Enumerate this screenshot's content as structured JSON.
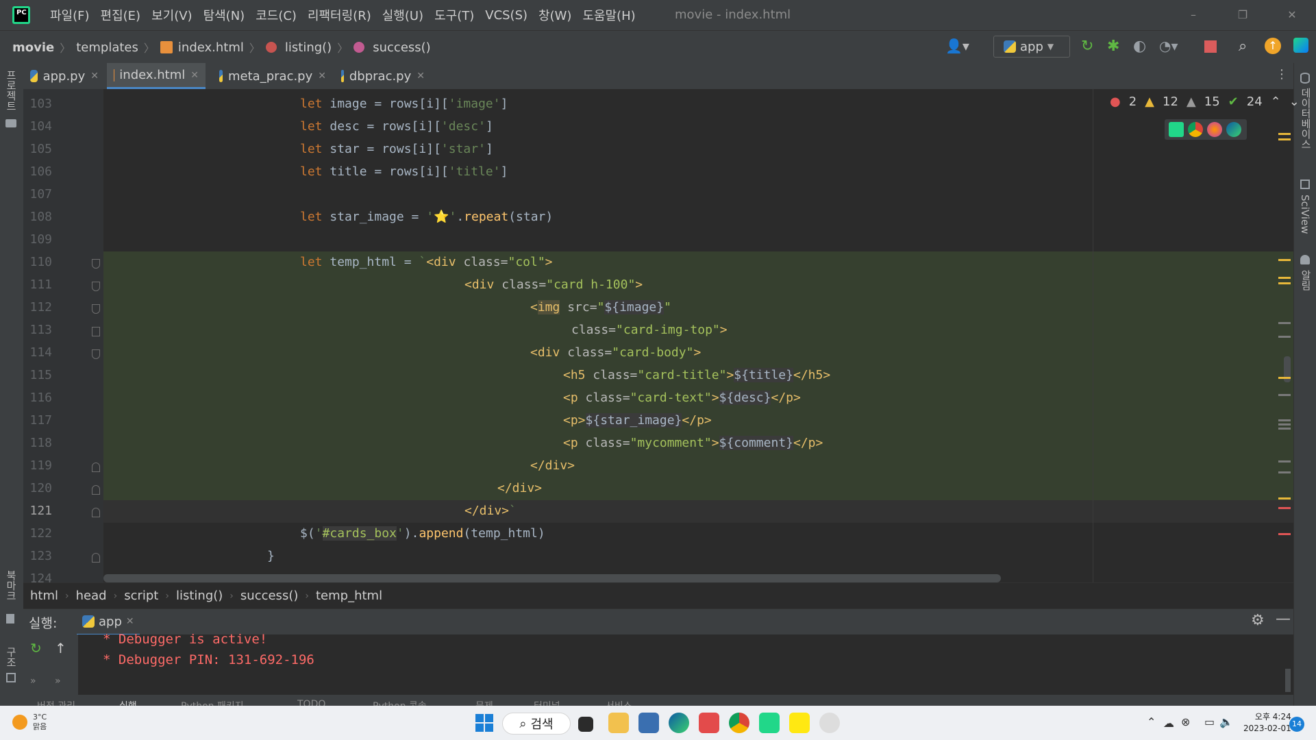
{
  "titlebar": {
    "app_icon": "pycharm-icon",
    "menu": [
      "파일(F)",
      "편집(E)",
      "보기(V)",
      "탐색(N)",
      "코드(C)",
      "리팩터링(R)",
      "실행(U)",
      "도구(T)",
      "VCS(S)",
      "창(W)",
      "도움말(H)"
    ],
    "window_title": "movie - index.html",
    "minimize": "–",
    "restore": "❐",
    "close": "✕"
  },
  "navbar": {
    "breadcrumb": [
      "movie",
      "templates",
      "index.html",
      "listing()",
      "success()"
    ],
    "run_config": "app"
  },
  "tabs": [
    {
      "label": "app.py",
      "icon": "python-file-icon"
    },
    {
      "label": "index.html",
      "icon": "html-file-icon"
    },
    {
      "label": "meta_prac.py",
      "icon": "python-file-icon"
    },
    {
      "label": "dbprac.py",
      "icon": "python-file-icon"
    }
  ],
  "left_strip": {
    "project": "프로젝트",
    "structure": "구조",
    "bookmarks": "북마크"
  },
  "right_strip": {
    "database": "데이터베이스",
    "sciview": "SciView",
    "notifications": "알림"
  },
  "inspections": {
    "errors": "2",
    "warnings": "12",
    "weak_warnings": "15",
    "ok": "24"
  },
  "editor": {
    "lines": [
      {
        "n": "103"
      },
      {
        "n": "104"
      },
      {
        "n": "105"
      },
      {
        "n": "106"
      },
      {
        "n": "107"
      },
      {
        "n": "108"
      },
      {
        "n": "109"
      },
      {
        "n": "110"
      },
      {
        "n": "111"
      },
      {
        "n": "112"
      },
      {
        "n": "113"
      },
      {
        "n": "114"
      },
      {
        "n": "115"
      },
      {
        "n": "116"
      },
      {
        "n": "117"
      },
      {
        "n": "118"
      },
      {
        "n": "119"
      },
      {
        "n": "120"
      },
      {
        "n": "121"
      },
      {
        "n": "122"
      },
      {
        "n": "123"
      },
      {
        "n": "124"
      }
    ]
  },
  "code_breadcrumb": [
    "html",
    "head",
    "script",
    "listing()",
    "success()",
    "temp_html"
  ],
  "run_panel": {
    "label": "실행:",
    "tab": "app",
    "output": [
      "* Debugger is active!",
      "* Debugger PIN: 131-692-196"
    ]
  },
  "bottom_tools": [
    "버전 관리",
    "실행",
    "Python 패키지",
    "TODO",
    "Python 콘솔",
    "문제",
    "터미널",
    "서비스"
  ],
  "taskbar": {
    "temp": "3°C",
    "weather": "맑음",
    "search": "검색",
    "time": "오후 4:24",
    "date": "2023-02-01",
    "badge": "14"
  }
}
